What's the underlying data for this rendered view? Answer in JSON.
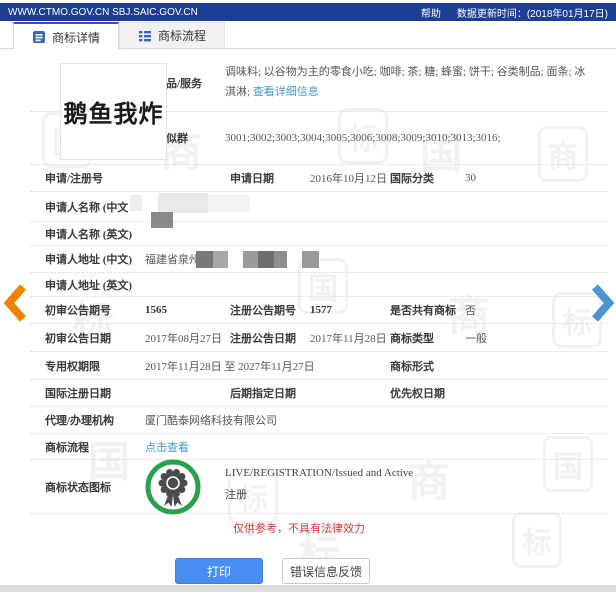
{
  "topbar": {
    "sites": "WWW.CTMO.GOV.CN SBJ.SAIC.GOV.CN",
    "help": "帮助",
    "update_time": "数据更新时间：(2018年01月17日)"
  },
  "tabs": {
    "detail": "商标详情",
    "process": "商标流程"
  },
  "tm_image_text": "鹅鱼我炸",
  "fields": {
    "goods": {
      "label": "商品/服务",
      "value": "调味料; 以谷物为主的零食小吃; 咖啡; 茶; 糖; 蜂蜜; 饼干; 谷类制品; 面条; 冰淇淋; ",
      "link": "查看详细信息"
    },
    "similar_group": {
      "label": "类似群",
      "value": "3001;3002;3003;3004;3005;3006;3008;3009;3010;3013;3016;"
    },
    "reg_no": {
      "label": "申请/注册号",
      "value": ""
    },
    "app_date": {
      "label": "申请日期",
      "value": "2016年10月12日"
    },
    "intl_class": {
      "label": "国际分类",
      "value": "30"
    },
    "applicant_cn": {
      "label": "申请人名称 (中文",
      "value": ""
    },
    "applicant_en": {
      "label": "申请人名称 (英文)",
      "value": ""
    },
    "addr_cn": {
      "label": "申请人地址 (中文)",
      "value": "福建省泉州"
    },
    "addr_en": {
      "label": "申请人地址 (英文)",
      "value": ""
    },
    "prelim_no": {
      "label": "初审公告期号",
      "value": "1565"
    },
    "reg_pub_no": {
      "label": "注册公告期号",
      "value": "1577"
    },
    "is_shared": {
      "label": "是否共有商标",
      "value": "否"
    },
    "prelim_date": {
      "label": "初审公告日期",
      "value": "2017年08月27日"
    },
    "reg_pub_date": {
      "label": "注册公告日期",
      "value": "2017年11月28日"
    },
    "tm_type": {
      "label": "商标类型",
      "value": "一般"
    },
    "term": {
      "label": "专用权期限",
      "value": "2017年11月28日 至 2027年11月27日"
    },
    "tm_form": {
      "label": "商标形式",
      "value": ""
    },
    "intl_reg_date": {
      "label": "国际注册日期",
      "value": ""
    },
    "later_desig_date": {
      "label": "后期指定日期",
      "value": ""
    },
    "priority_date": {
      "label": "优先权日期",
      "value": ""
    },
    "agency": {
      "label": "代理/办理机构",
      "value": "厦门酷泰网络科技有限公司"
    },
    "process": {
      "label": "商标流程",
      "link": "点击查看"
    },
    "status": {
      "label": "商标状态图标",
      "line1": "LIVE/REGISTRATION/Issued and Active",
      "line2": "注册"
    }
  },
  "note": "仅供参考，不具有法律效力",
  "buttons": {
    "print": "打印",
    "feedback": "错误信息反馈"
  },
  "colors": {
    "topbar_bg": "#1d3d94",
    "link_blue": "#3e9ad2",
    "badge_green": "#2aa14c",
    "note_red": "#e03131",
    "print_btn_blue": "#4a8df0",
    "arrow_orange": "#f18101",
    "arrow_blue": "#4a96d2"
  },
  "watermarks": [
    "国",
    "商",
    "标",
    "国",
    "商",
    "标",
    "国",
    "商",
    "标",
    "国",
    "标",
    "商",
    "国",
    "标",
    "标"
  ]
}
